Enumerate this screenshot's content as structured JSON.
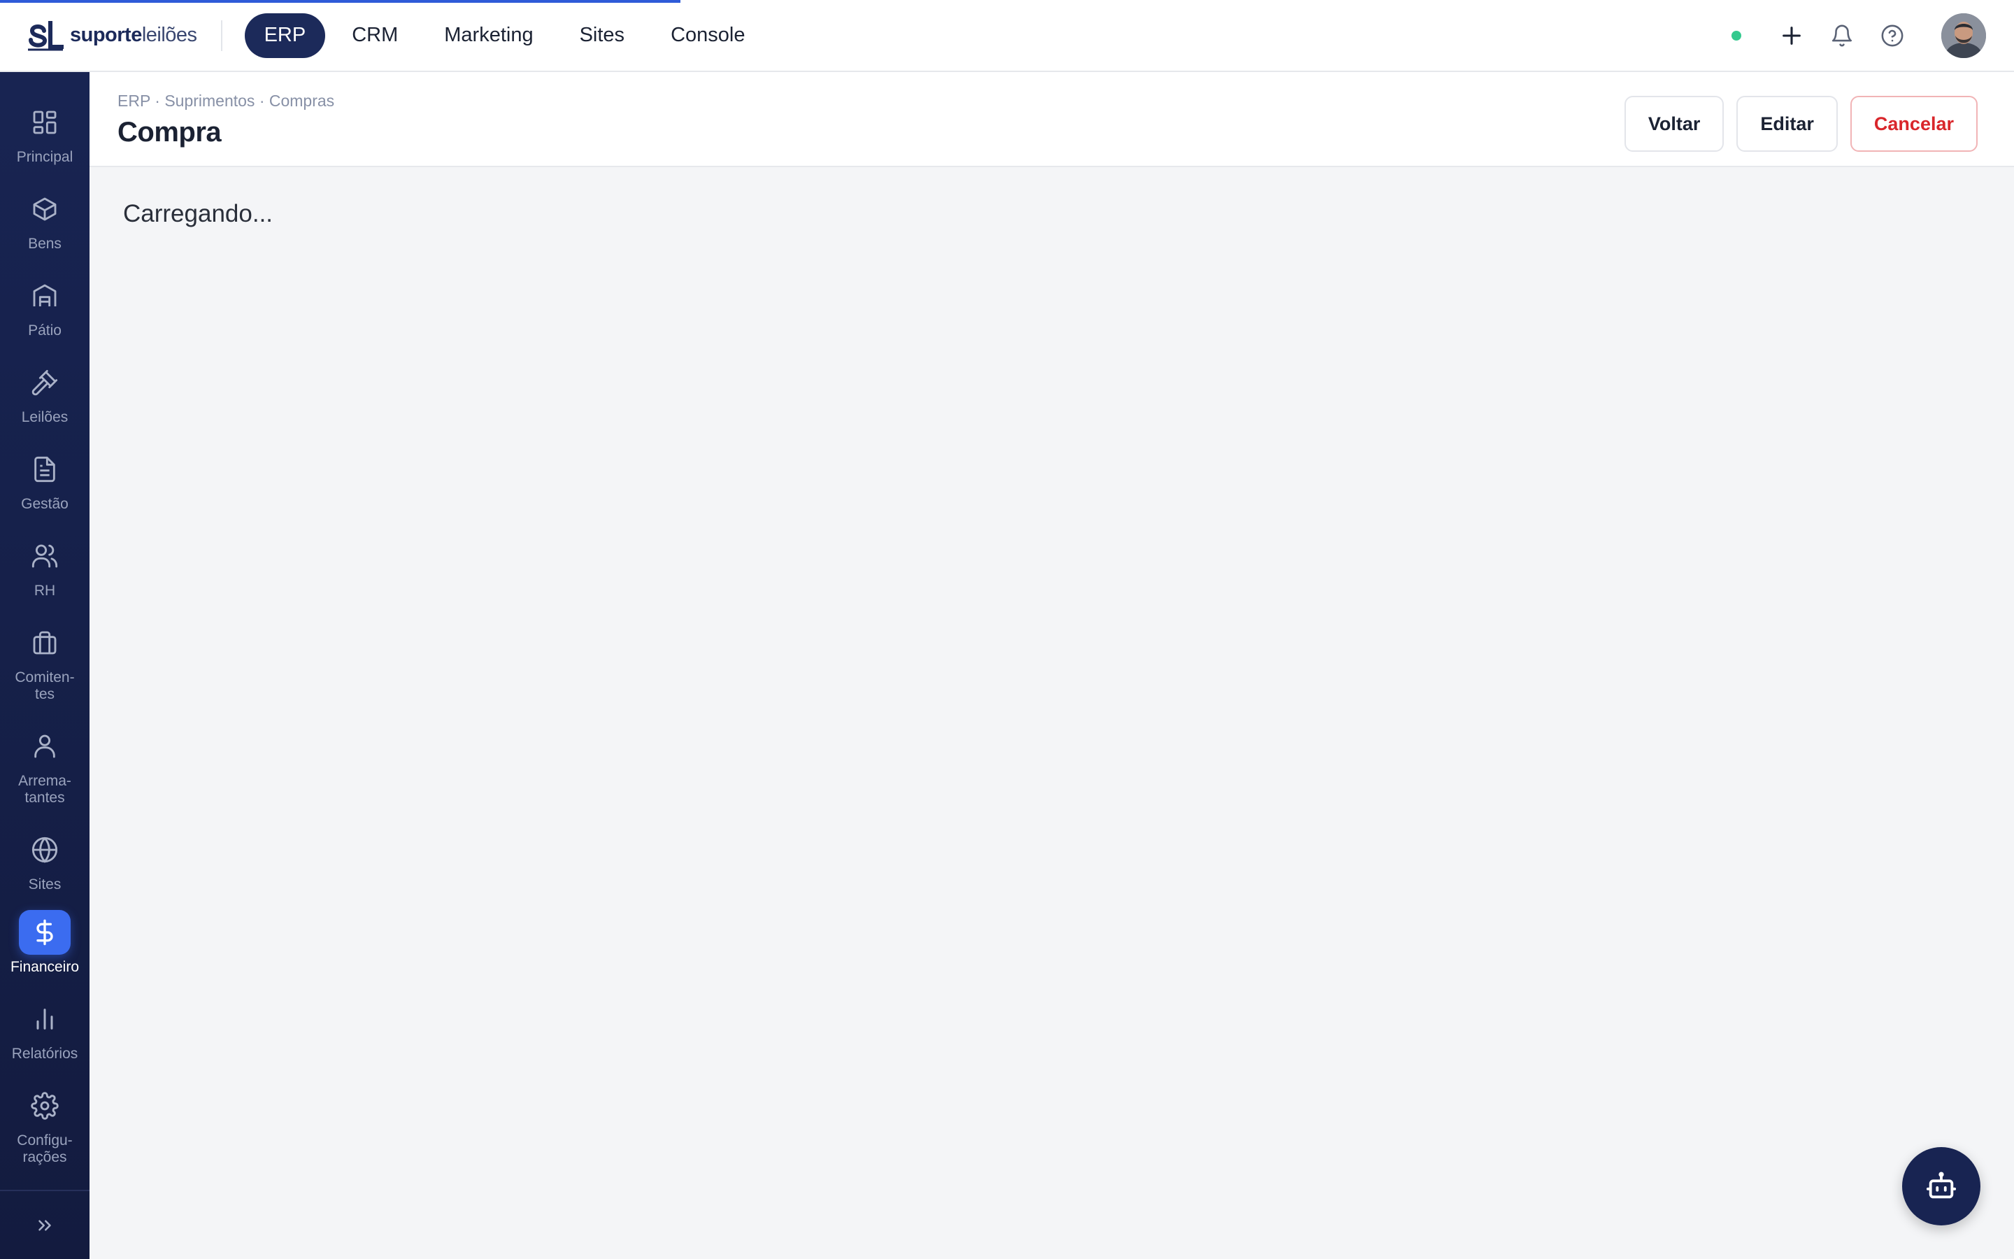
{
  "progress": {
    "fraction": 0.338
  },
  "brand": {
    "logo_mark": "SL",
    "name_bold": "suporte",
    "name_light": "leilões"
  },
  "top_nav": {
    "items": [
      {
        "label": "ERP",
        "active": true
      },
      {
        "label": "CRM",
        "active": false
      },
      {
        "label": "Marketing",
        "active": false
      },
      {
        "label": "Sites",
        "active": false
      },
      {
        "label": "Console",
        "active": false
      }
    ],
    "status_color": "#34c98e",
    "icons": [
      "plus-icon",
      "bell-icon",
      "help-circle-icon"
    ]
  },
  "sidebar": {
    "items": [
      {
        "label": "Principal",
        "icon": "dashboard-icon",
        "active": false
      },
      {
        "label": "Bens",
        "icon": "box-icon",
        "active": false
      },
      {
        "label": "Pátio",
        "icon": "warehouse-icon",
        "active": false
      },
      {
        "label": "Leilões",
        "icon": "gavel-icon",
        "active": false
      },
      {
        "label": "Gestão",
        "icon": "document-icon",
        "active": false
      },
      {
        "label": "RH",
        "icon": "users-icon",
        "active": false
      },
      {
        "label": "Comiten-\ntes",
        "icon": "briefcase-icon",
        "active": false
      },
      {
        "label": "Arrema-\ntantes",
        "icon": "user-icon",
        "active": false
      },
      {
        "label": "Sites",
        "icon": "globe-icon",
        "active": false
      },
      {
        "label": "Financeiro",
        "icon": "dollar-icon",
        "active": true
      },
      {
        "label": "Relatórios",
        "icon": "bar-chart-icon",
        "active": false
      },
      {
        "label": "Configu-\nrações",
        "icon": "gear-icon",
        "active": false
      }
    ],
    "collapse_icon": "chevrons-right-icon"
  },
  "header": {
    "breadcrumb": "ERP · Suprimentos · Compras",
    "title": "Compra",
    "buttons": {
      "back": "Voltar",
      "edit": "Editar",
      "cancel": "Cancelar"
    }
  },
  "content": {
    "loading_text": "Carregando..."
  },
  "colors": {
    "accent": "#3b6cf0",
    "sidebar": "#182452",
    "danger": "#d9262b"
  }
}
